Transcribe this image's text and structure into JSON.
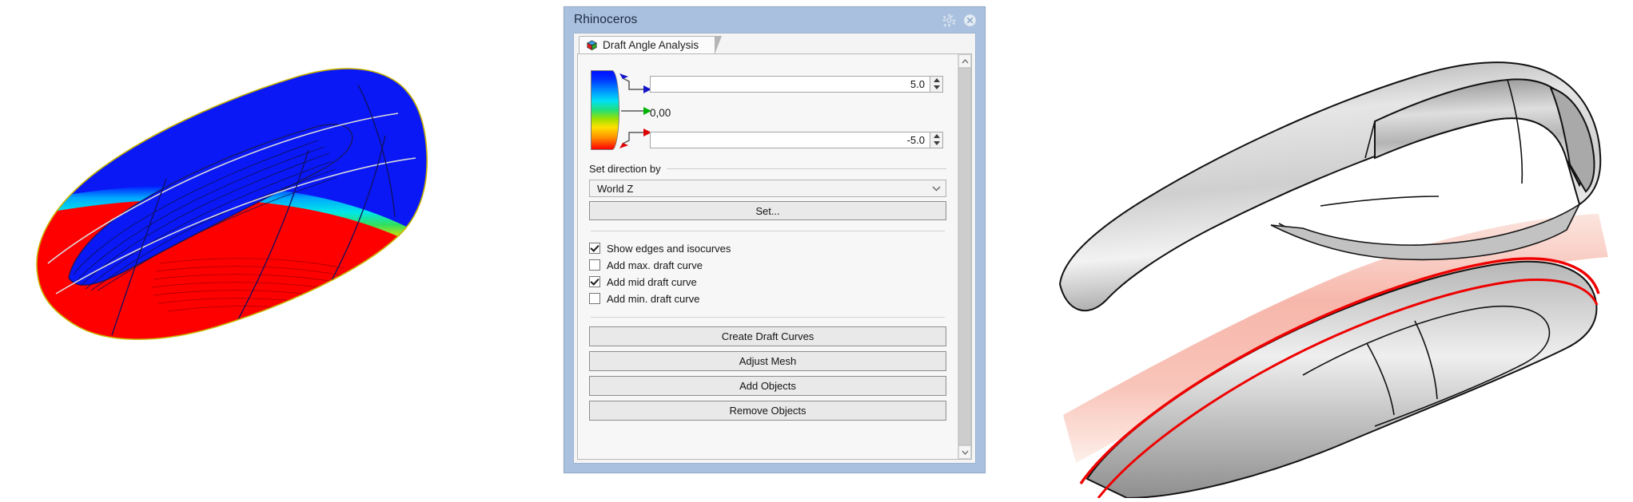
{
  "window": {
    "title": "Rhinoceros",
    "gear_icon": "gear-icon",
    "close_icon": "close-icon"
  },
  "tab": {
    "label": "Draft Angle Analysis",
    "icon": "rhino-cube-icon"
  },
  "analysis": {
    "max_value": "5.0",
    "mid_value": "0,00",
    "min_value": "-5.0",
    "gradient_icon": "draft-angle-color-ramp",
    "max_arrow_icon": "blue-arrow-icon",
    "mid_arrow_icon": "green-arrow-icon",
    "min_arrow_icon": "red-arrow-icon",
    "colors": {
      "max": "#0010ff",
      "mid": "#00cc00",
      "min": "#ff0000"
    }
  },
  "direction_group": {
    "label": "Set direction by",
    "combo_value": "World Z",
    "combo_chevron": "chevron-down-icon",
    "set_button": "Set..."
  },
  "checkboxes": [
    {
      "label": "Show edges and isocurves",
      "checked": true
    },
    {
      "label": "Add max. draft curve",
      "checked": false
    },
    {
      "label": "Add mid draft curve",
      "checked": true
    },
    {
      "label": "Add min. draft curve",
      "checked": false
    }
  ],
  "action_buttons": [
    {
      "label": "Create Draft Curves"
    },
    {
      "label": "Adjust Mesh"
    },
    {
      "label": "Add Objects"
    },
    {
      "label": "Remove Objects"
    }
  ],
  "scrollbar": {
    "up_icon": "chevron-up-icon",
    "down_icon": "chevron-down-icon"
  },
  "viewports": {
    "left": {
      "name": "draft-angle-shaded-model",
      "description": "Boat hull shaded by draft angle: blue positive-draft upper surface, red negative-draft lower surface, cyan/green/yellow transition band",
      "colors": {
        "positive": "#0010ff",
        "negative": "#ff0000",
        "transition": "#00e0f5",
        "edge": "#c8b400"
      }
    },
    "right": {
      "name": "draft-curve-result-model",
      "description": "Grey shaded hull surfaces with red mid draft curve outline and pink reflected band",
      "colors": {
        "surface": "#b0b0b0",
        "curve": "#ee0000",
        "band": "#f7b6ae"
      }
    }
  }
}
